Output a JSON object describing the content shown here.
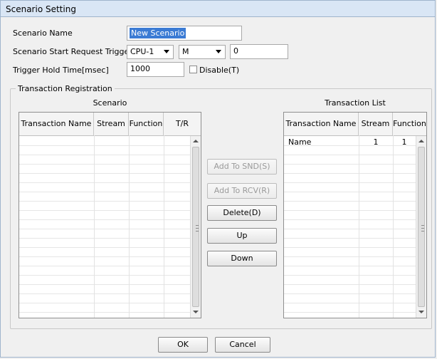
{
  "window": {
    "title": "Scenario Setting"
  },
  "form": {
    "scenario_name_label": "Scenario Name",
    "scenario_name_value": "New Scenario",
    "trigger_label": "Scenario Start Request Trigger",
    "trigger_cpu_value": "CPU-1",
    "trigger_device_value": "M",
    "trigger_address_value": "0",
    "hold_time_label": "Trigger Hold Time[msec]",
    "hold_time_value": "1000",
    "disable_label": "Disable(T)",
    "disable_checked": false
  },
  "registration": {
    "group_label": "Transaction Registration",
    "scenario_title": "Scenario",
    "scenario_columns": [
      "Transaction Name",
      "Stream",
      "Function",
      "T/R"
    ],
    "list_title": "Transaction List",
    "list_columns": [
      "Transaction Name",
      "Stream",
      "Function"
    ],
    "list_rows": [
      {
        "name": "Name",
        "stream": "1",
        "function": "1"
      }
    ]
  },
  "buttons": {
    "add_snd": "Add To SND(S)",
    "add_rcv": "Add To RCV(R)",
    "delete": "Delete(D)",
    "up": "Up",
    "down": "Down",
    "ok": "OK",
    "cancel": "Cancel"
  }
}
